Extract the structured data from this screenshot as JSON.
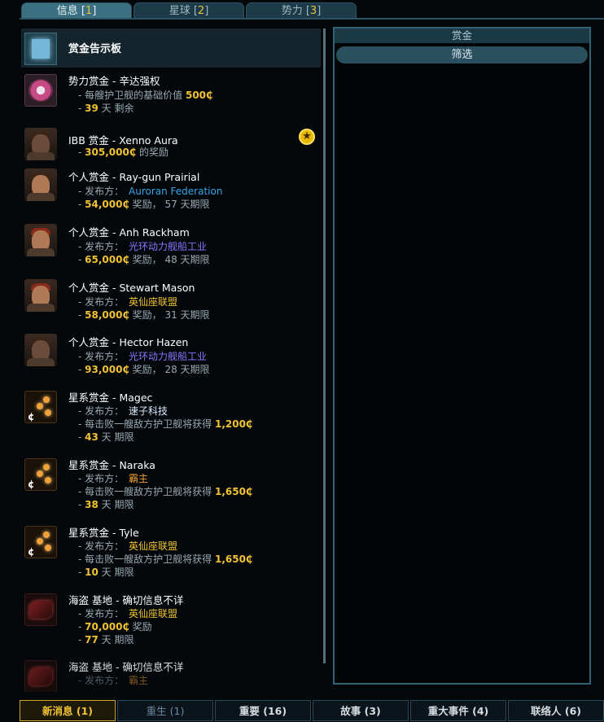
{
  "tabs": [
    {
      "label": "信息 [",
      "key": "1",
      "close": "]"
    },
    {
      "label": "星球 [",
      "key": "2",
      "close": "]"
    },
    {
      "label": "势力 [",
      "key": "3",
      "close": "]"
    }
  ],
  "board": {
    "title": "赏金告示板"
  },
  "bounties": [
    {
      "title": "势力赏金 - 辛达强权",
      "line1_pre": "- 每艘护卫舰的基础价值 ",
      "line1_val": "500₵",
      "line2_val": "39",
      "line2_post": " 天 剩余"
    },
    {
      "title": "IBB 赏金 - Xenno Aura",
      "val": "305,000₵",
      "post": " 的奖励"
    },
    {
      "title": "个人赏金 - Ray-gun Prairial",
      "issuer_label": "- 发布方：",
      "issuer": "Auroran Federation",
      "val": "54,000₵",
      "post": " 奖励， 57 天期限"
    },
    {
      "title": "个人赏金 - Anh Rackham",
      "issuer_label": "- 发布方：",
      "issuer": "光环动力舰船工业",
      "val": "65,000₵",
      "post": " 奖励， 48 天期限"
    },
    {
      "title": "个人赏金 - Stewart Mason",
      "issuer_label": "- 发布方：",
      "issuer": "英仙座联盟",
      "val": "58,000₵",
      "post": " 奖励， 31 天期限"
    },
    {
      "title": "个人赏金 - Hector Hazen",
      "issuer_label": "- 发布方：",
      "issuer": "光环动力舰船工业",
      "val": "93,000₵",
      "post": " 奖励， 28 天期限"
    },
    {
      "title": "星系赏金 - Magec",
      "issuer_label": "- 发布方：",
      "issuer": "速子科技",
      "line_pre": "- 每击败一艘敌方护卫舰将获得 ",
      "line_val": "1,200₵",
      "days": "43",
      "days_post": " 天 期限"
    },
    {
      "title": "星系赏金 - Naraka",
      "issuer_label": "- 发布方：",
      "issuer": "霸主",
      "line_pre": "- 每击败一艘敌方护卫舰将获得 ",
      "line_val": "1,650₵",
      "days": "38",
      "days_post": " 天 期限"
    },
    {
      "title": "星系赏金 - Tyle",
      "issuer_label": "- 发布方：",
      "issuer": "英仙座联盟",
      "line_pre": "- 每击败一艘敌方护卫舰将获得 ",
      "line_val": "1,650₵",
      "days": "10",
      "days_post": " 天 期限"
    },
    {
      "title": "海盗 基地 - 确切信息不详",
      "issuer_label": "- 发布方：",
      "issuer": "英仙座联盟",
      "val": "70,000₵",
      "post": " 奖励",
      "days": "77",
      "days_post": " 天 期限"
    },
    {
      "title": "海盗 基地 - 确切信息不详",
      "issuer_label": "- 发布方：",
      "issuer": "霸主"
    }
  ],
  "panel": {
    "title": "赏金",
    "filter": "筛选"
  },
  "bottom_tabs": [
    {
      "label": "新消息 (1)"
    },
    {
      "label": "重生 (1)"
    },
    {
      "label": "重要 (16)"
    },
    {
      "label": "故事 (3)"
    },
    {
      "label": "重大事件 (4)"
    },
    {
      "label": "联络人 (6)"
    }
  ],
  "colors": {
    "accent_gold": "#f1c232",
    "blue_faction": "#37a4e6",
    "purple_faction": "#8b74ff",
    "orange_faction": "#f0a030"
  }
}
